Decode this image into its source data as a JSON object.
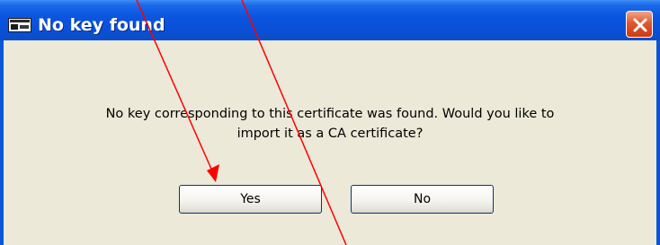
{
  "window": {
    "title": "No key found",
    "icon": "app-window-icon",
    "close_icon": "close-icon"
  },
  "message": {
    "line1": "No key corresponding to this certificate was found. Would you like to",
    "line2": "import it as a CA certificate?"
  },
  "buttons": {
    "yes_label": "Yes",
    "no_label": "No"
  },
  "colors": {
    "titlebar": "#0a50d9",
    "client_background": "#ece9d8",
    "close_button": "#e2572e",
    "annotation_arrows": "#ff0000"
  }
}
